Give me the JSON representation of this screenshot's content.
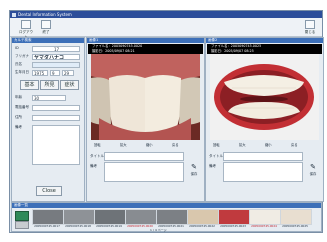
{
  "app": {
    "title": "Dental Information System",
    "accent": "#3c6fb8"
  },
  "toolbar": {
    "btn1": "ログアウト",
    "btn2": "終了",
    "btn3": "閉じる"
  },
  "patient": {
    "header": "カルテ検索",
    "id_label": "ID",
    "id_value": "17",
    "kana_label": "フリガナ",
    "kana_value": "ヤマダハナコ",
    "name_label": "氏名",
    "birth_label": "生年月日",
    "birth_year": "1975",
    "birth_month": "9",
    "birth_day": "29",
    "btn_basic": "基本",
    "btn_exam": "所見",
    "btn_treat": "症状",
    "age_label": "年齢",
    "age_value": "30",
    "f1": "電話番号",
    "f2": "住所",
    "f3": "備考",
    "search_button": "Close"
  },
  "viewer_left": {
    "header": "画像1",
    "info1": "ファイル名：2005090745.0020",
    "info2": "撮影日：2005/09/07 08:21",
    "ctrl": [
      "回転",
      "拡大",
      "縮小",
      "戻る"
    ],
    "comment_label": "タイトル",
    "note_label": "備考",
    "save": "保存"
  },
  "viewer_right": {
    "header": "画像2",
    "info1": "ファイル名：2005090745.0025",
    "info2": "撮影日：2005/09/07 08:25",
    "ctrl": [
      "回転",
      "拡大",
      "縮小",
      "戻る"
    ],
    "comment_label": "タイトル",
    "note_label": "備考",
    "save": "保存"
  },
  "strip": {
    "header": "画像一覧",
    "pages": "1 / 4 ページ",
    "thumbs": [
      {
        "label": "2005090745.0017"
      },
      {
        "label": "2005090745.0018"
      },
      {
        "label": "2005090745.0019"
      },
      {
        "label": "2005090745.0020"
      },
      {
        "label": "2005090745.0021"
      },
      {
        "label": "2005090745.0022"
      },
      {
        "label": "2005090745.0023"
      },
      {
        "label": "2005090745.0024"
      },
      {
        "label": "2005090745.0025"
      }
    ]
  }
}
